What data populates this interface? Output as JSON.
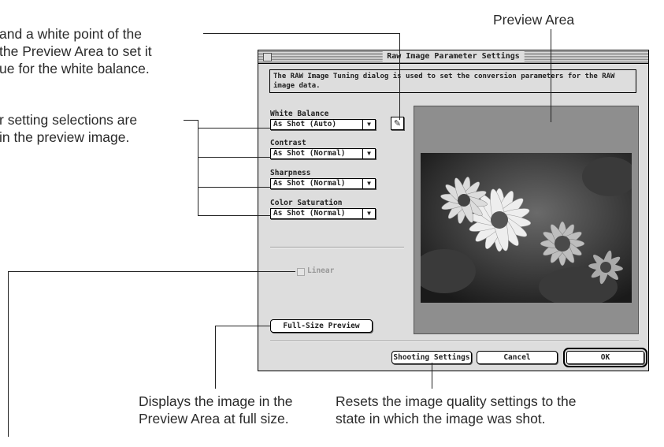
{
  "callouts": {
    "eyedropper": [
      "and a white point of the",
      "the Preview Area to set it",
      "ue for the white balance."
    ],
    "selections": [
      "r setting selections are",
      "in the preview image."
    ],
    "preview_area": "Preview Area",
    "full_size": [
      "Displays the image in the",
      "Preview Area at full size."
    ],
    "shooting": [
      "Resets the image quality settings to the",
      "state in which the image was shot."
    ]
  },
  "dialog": {
    "title": "Raw Image Parameter Settings",
    "description": "The RAW Image Tuning dialog is used to set the conversion parameters for the RAW image data.",
    "white_balance": {
      "label": "White Balance",
      "value": "As Shot (Auto)"
    },
    "contrast": {
      "label": "Contrast",
      "value": "As Shot (Normal)"
    },
    "sharpness": {
      "label": "Sharpness",
      "value": "As Shot (Normal)"
    },
    "color_saturation": {
      "label": "Color Saturation",
      "value": "As Shot (Normal)"
    },
    "linear_label": "Linear",
    "full_size_preview": "Full-Size Preview",
    "shooting_settings": "Shooting Settings",
    "cancel": "Cancel",
    "ok": "OK"
  }
}
